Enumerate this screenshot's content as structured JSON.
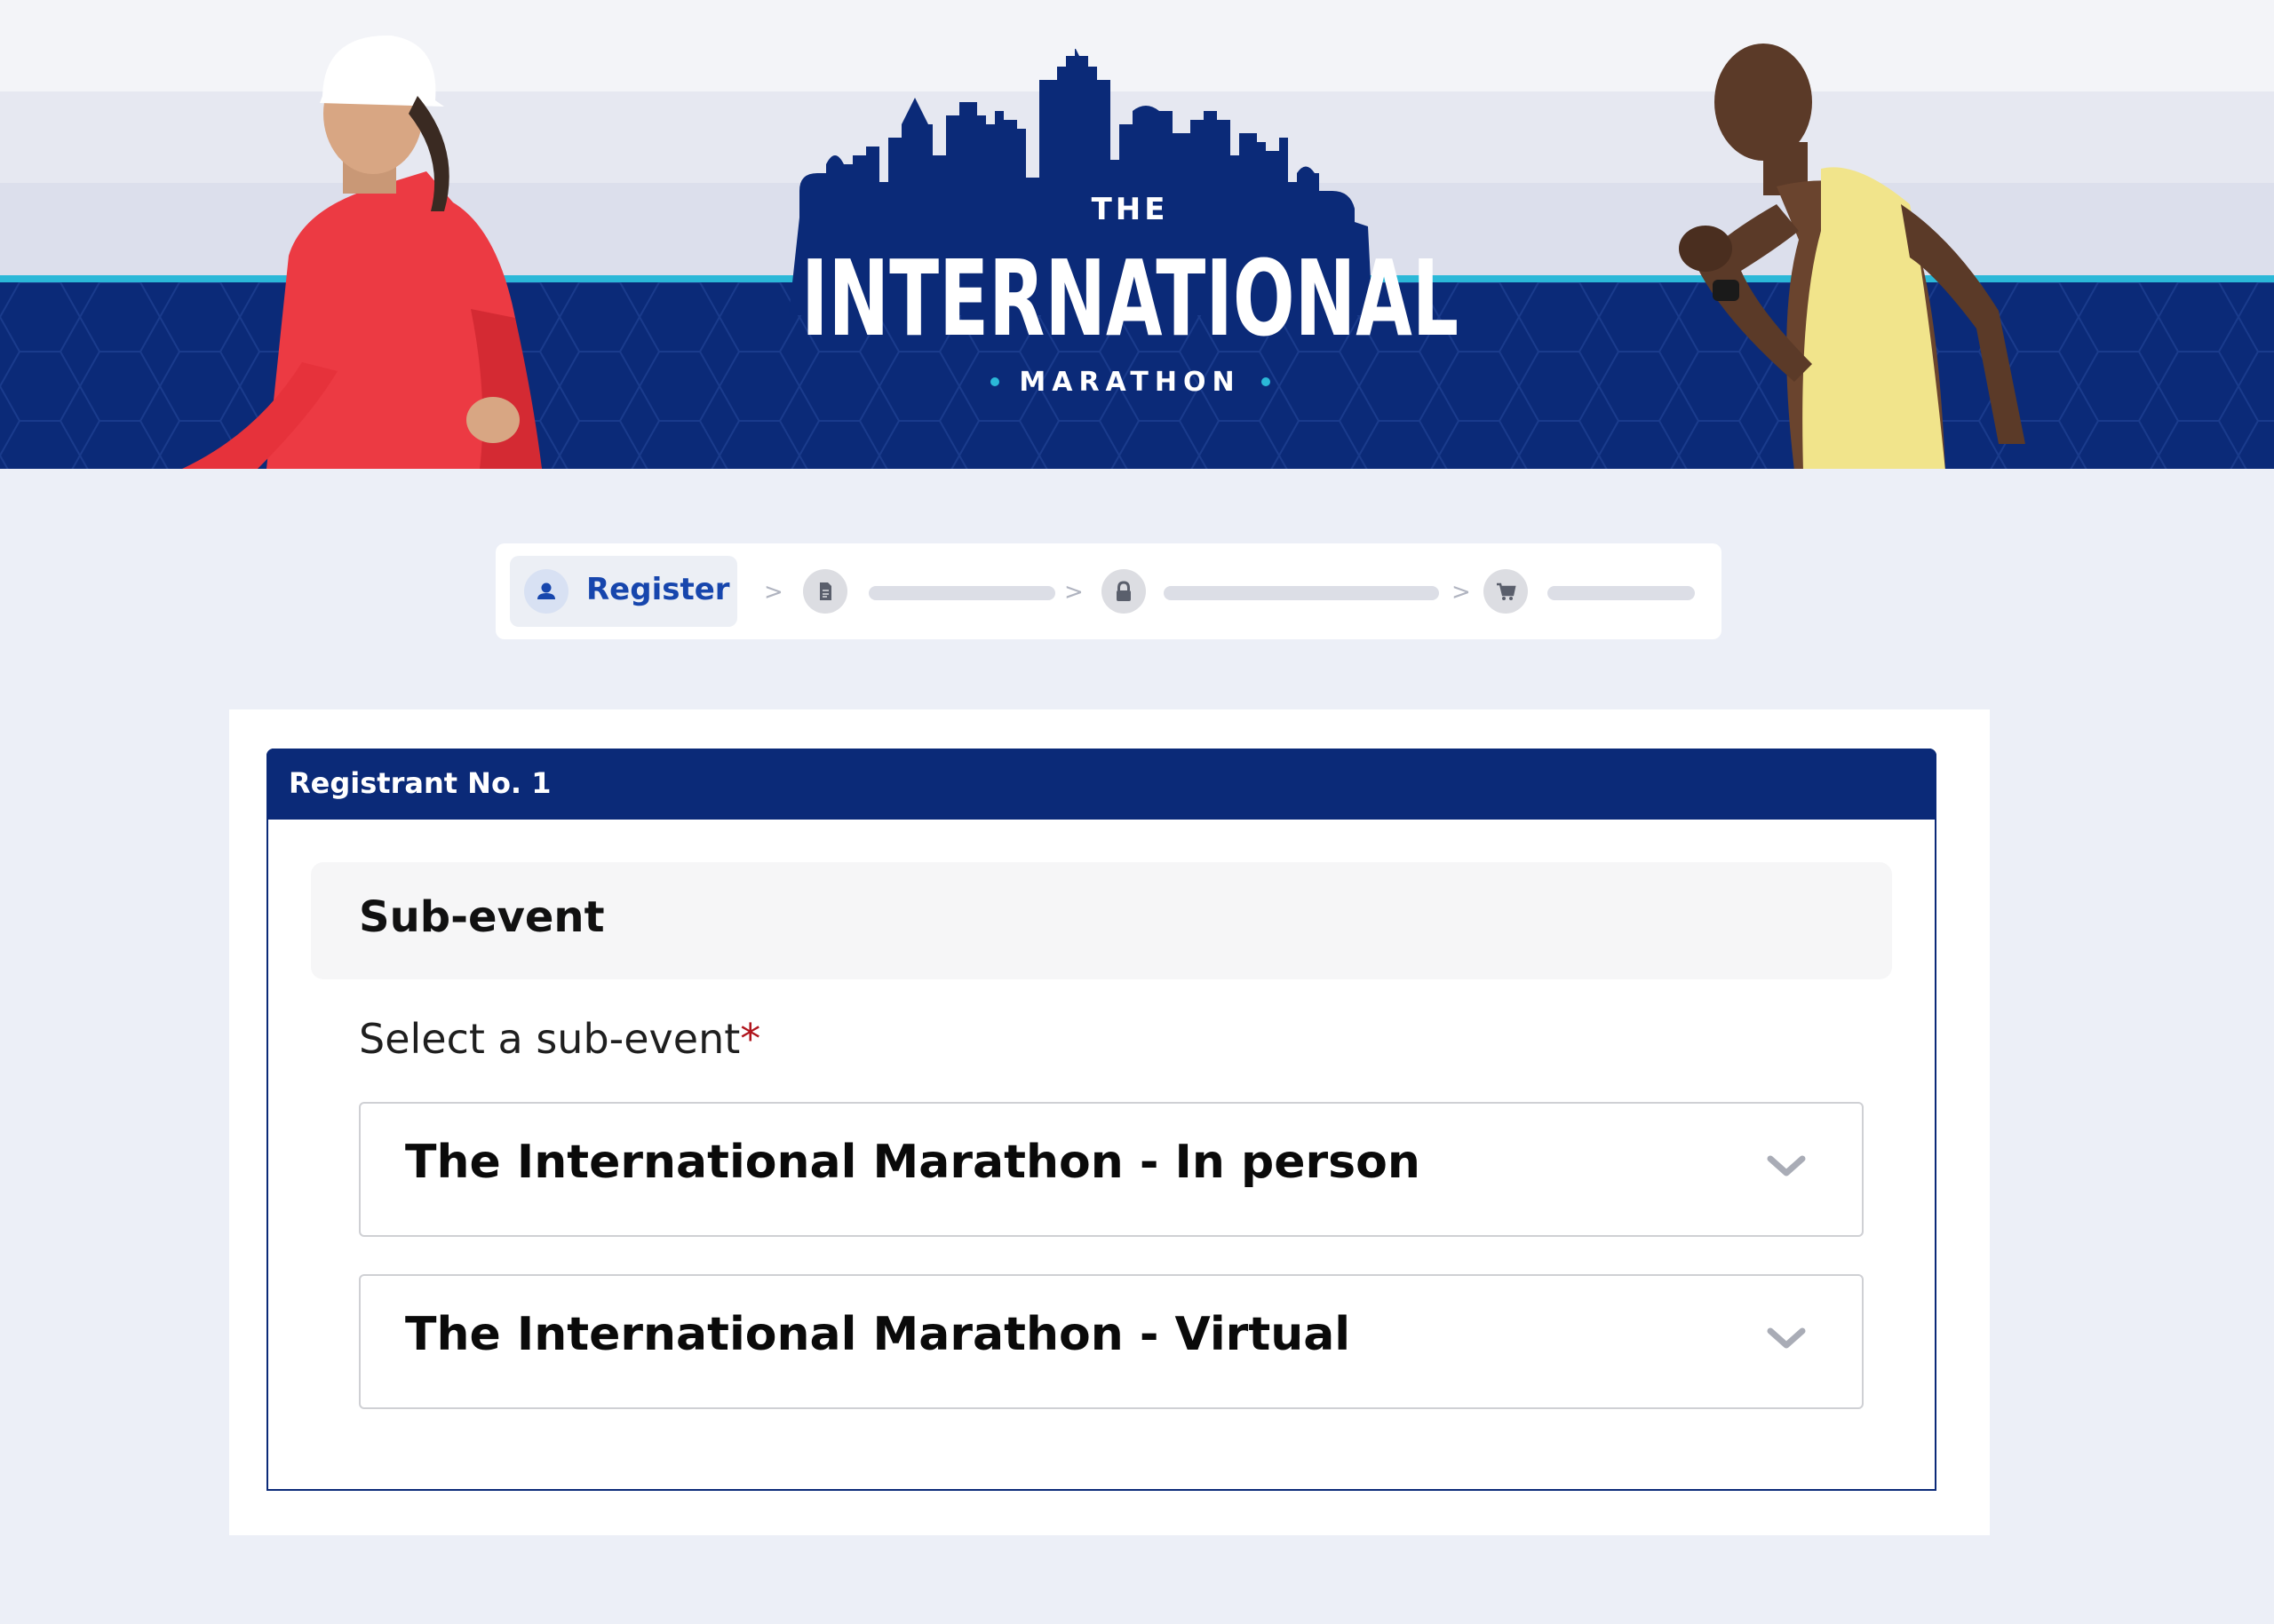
{
  "brand": {
    "logo_top": "THE",
    "logo_main": "INTERNATIONAL",
    "logo_sub": "MARATHON"
  },
  "stepper": {
    "steps": [
      {
        "label": "Register",
        "icon": "user-icon",
        "active": true
      },
      {
        "label": "",
        "icon": "document-icon",
        "active": false
      },
      {
        "label": "",
        "icon": "lock-icon",
        "active": false
      },
      {
        "label": "",
        "icon": "cart-icon",
        "active": false
      }
    ],
    "separator": ">"
  },
  "registrant": {
    "title": "Registrant No. 1",
    "section_title": "Sub-event",
    "select_label": "Select a sub-event",
    "required_mark": "*",
    "options": [
      {
        "label": "The International Marathon - In person"
      },
      {
        "label": "The International Marathon - Virtual"
      }
    ]
  },
  "colors": {
    "navy": "#0b2a78",
    "accent_cyan": "#2bb8d8",
    "link_blue": "#1746ad",
    "required_red": "#b0151d"
  }
}
